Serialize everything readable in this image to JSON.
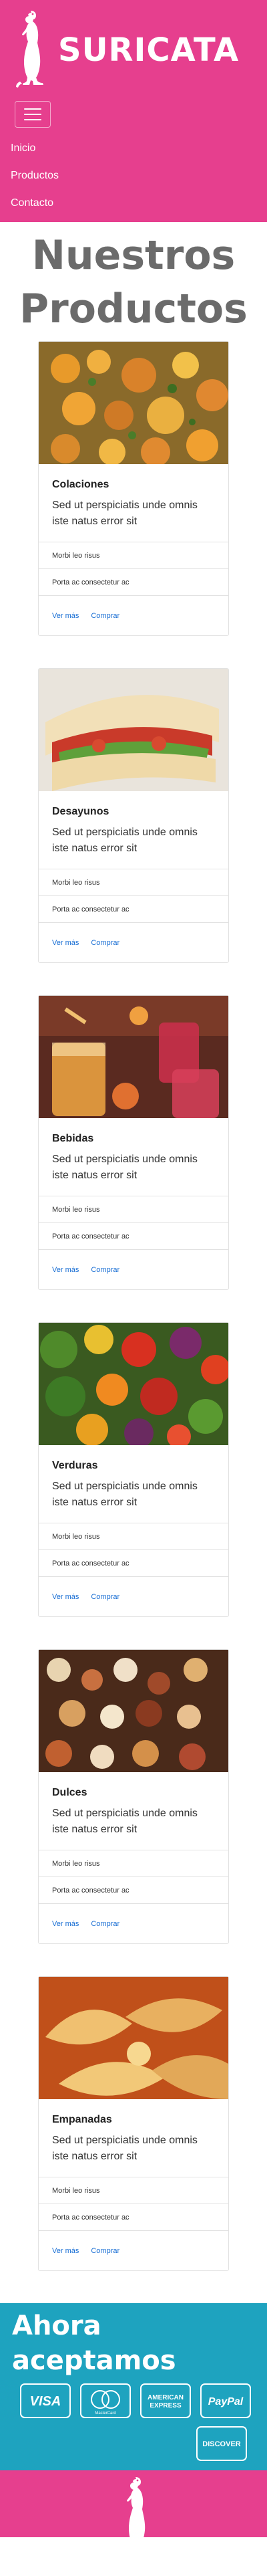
{
  "header": {
    "brand": "SURICATA",
    "nav": [
      "Inicio",
      "Productos",
      "Contacto"
    ]
  },
  "main": {
    "title": "Nuestros Productos"
  },
  "products": [
    {
      "title": "Colaciones",
      "text": "Sed ut perspiciatis unde omnis iste natus error sit",
      "items": [
        "Morbi leo risus",
        "Porta ac consectetur ac"
      ],
      "link_more": "Ver más",
      "link_buy": "Comprar"
    },
    {
      "title": "Desayunos",
      "text": "Sed ut perspiciatis unde omnis iste natus error sit",
      "items": [
        "Morbi leo risus",
        "Porta ac consectetur ac"
      ],
      "link_more": "Ver más",
      "link_buy": "Comprar"
    },
    {
      "title": "Bebidas",
      "text": "Sed ut perspiciatis unde omnis iste natus error sit",
      "items": [
        "Morbi leo risus",
        "Porta ac consectetur ac"
      ],
      "link_more": "Ver más",
      "link_buy": "Comprar"
    },
    {
      "title": "Verduras",
      "text": "Sed ut perspiciatis unde omnis iste natus error sit",
      "items": [
        "Morbi leo risus",
        "Porta ac consectetur ac"
      ],
      "link_more": "Ver más",
      "link_buy": "Comprar"
    },
    {
      "title": "Dulces",
      "text": "Sed ut perspiciatis unde omnis iste natus error sit",
      "items": [
        "Morbi leo risus",
        "Porta ac consectetur ac"
      ],
      "link_more": "Ver más",
      "link_buy": "Comprar"
    },
    {
      "title": "Empanadas",
      "text": "Sed ut perspiciatis unde omnis iste natus error sit",
      "items": [
        "Morbi leo risus",
        "Porta ac consectetur ac"
      ],
      "link_more": "Ver más",
      "link_buy": "Comprar"
    }
  ],
  "payments": {
    "title_line1": "Ahora",
    "title_line2": "aceptamos",
    "visa": "VISA",
    "mastercard": "MasterCard",
    "amex_line1": "AMERICAN",
    "amex_line2": "EXPRESS",
    "paypal": "PayPal",
    "discover": "DISCOVER"
  },
  "colors": {
    "brand_pink": "#e63f8e",
    "payments_teal": "#1ea3bf",
    "link_blue": "#1a6fd4",
    "title_gray": "#6b6b6b"
  },
  "icons": [
    "meerkat-logo-icon",
    "hamburger-menu-icon",
    "visa-card-icon",
    "mastercard-icon",
    "amex-card-icon",
    "paypal-card-icon",
    "discover-card-icon"
  ]
}
